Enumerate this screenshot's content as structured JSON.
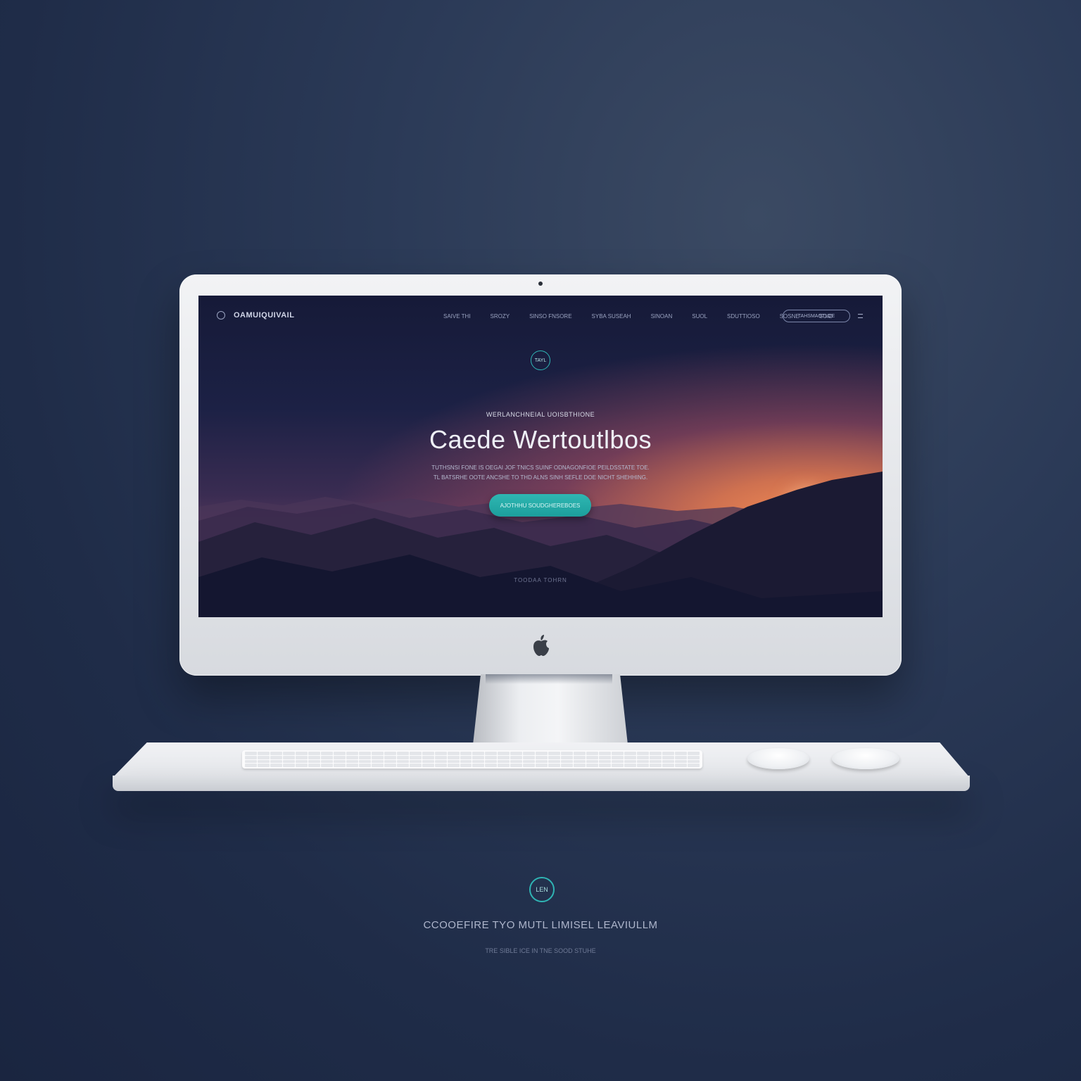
{
  "screen": {
    "brand": "OAMUIQUIVAIL",
    "nav": {
      "items": [
        "SAIVE THI",
        "SROZY",
        "SINSO FNSORE",
        "SYBA SUSEAH",
        "SINOAN",
        "SUOL",
        "SDUTTIOSO",
        "SOSNE",
        "SOID"
      ],
      "cta": "TAHSMAOTLOE"
    },
    "hero": {
      "badge": "TAYL",
      "kicker": "WERLANCHNEIAL UOISBTHIONE",
      "title": "Caede Wertoutlbos",
      "subtitle_line1": "TUTHSNSI FONE IS OEGAI JOF TNICS SUINF ODNAGONFIOE PEILDSSTATE TOE.",
      "subtitle_line2": "TL BATSRHE OOTE ANCSHE TO THD ALNS SINH SEFLE DOE NICHT SHEHHING.",
      "button": "AJOTHHU SOUDGHEREBOES",
      "scroll_label": "TOODAA TOHRN"
    }
  },
  "footer": {
    "badge": "LEN",
    "title": "CCOOEFIRE TYO MUTL LIMISEL LEAVIULLM",
    "subtitle": "TRE SIBLE ICE IN TNE SOOD STUHE"
  },
  "colors": {
    "accent": "#2fb4b4",
    "background": "#1f2c48"
  },
  "icons": [
    "apple-logo-icon",
    "brand-circle-icon",
    "menu-icon"
  ]
}
